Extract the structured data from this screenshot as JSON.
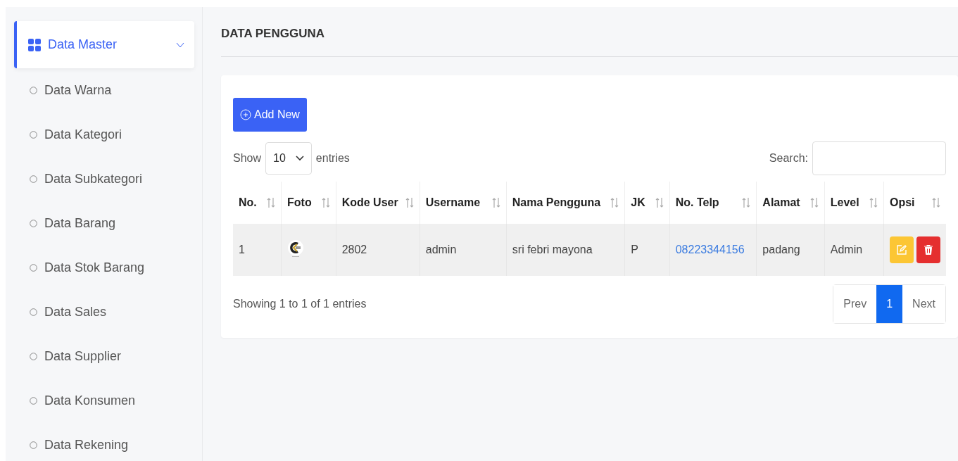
{
  "sidebar": {
    "menu": {
      "label": "Data Master",
      "expanded": true
    },
    "items": [
      {
        "label": "Data Warna"
      },
      {
        "label": "Data Kategori"
      },
      {
        "label": "Data Subkategori"
      },
      {
        "label": "Data Barang"
      },
      {
        "label": "Data Stok Barang"
      },
      {
        "label": "Data Sales"
      },
      {
        "label": "Data Supplier"
      },
      {
        "label": "Data Konsumen"
      },
      {
        "label": "Data Rekening"
      }
    ]
  },
  "page_title": "DATA PENGGUNA",
  "add_button": "Add New",
  "length": {
    "show": "Show",
    "value": "10",
    "entries": "entries"
  },
  "search": {
    "label": "Search:"
  },
  "table": {
    "columns": [
      "No.",
      "Foto",
      "Kode User",
      "Username",
      "Nama Pengguna",
      "JK",
      "No. Telp",
      "Alamat",
      "Level",
      "Opsi"
    ],
    "rows": [
      {
        "no": "1",
        "kode_user": "2802",
        "username": "admin",
        "nama": "sri febri mayona",
        "jk": "P",
        "telp": "08223344156",
        "alamat": "padang",
        "level": "Admin"
      }
    ]
  },
  "info": "Showing 1 to 1 of 1 entries",
  "pagination": {
    "prev": "Prev",
    "pages": [
      {
        "label": "1",
        "selected": true
      }
    ],
    "next": "Next"
  }
}
